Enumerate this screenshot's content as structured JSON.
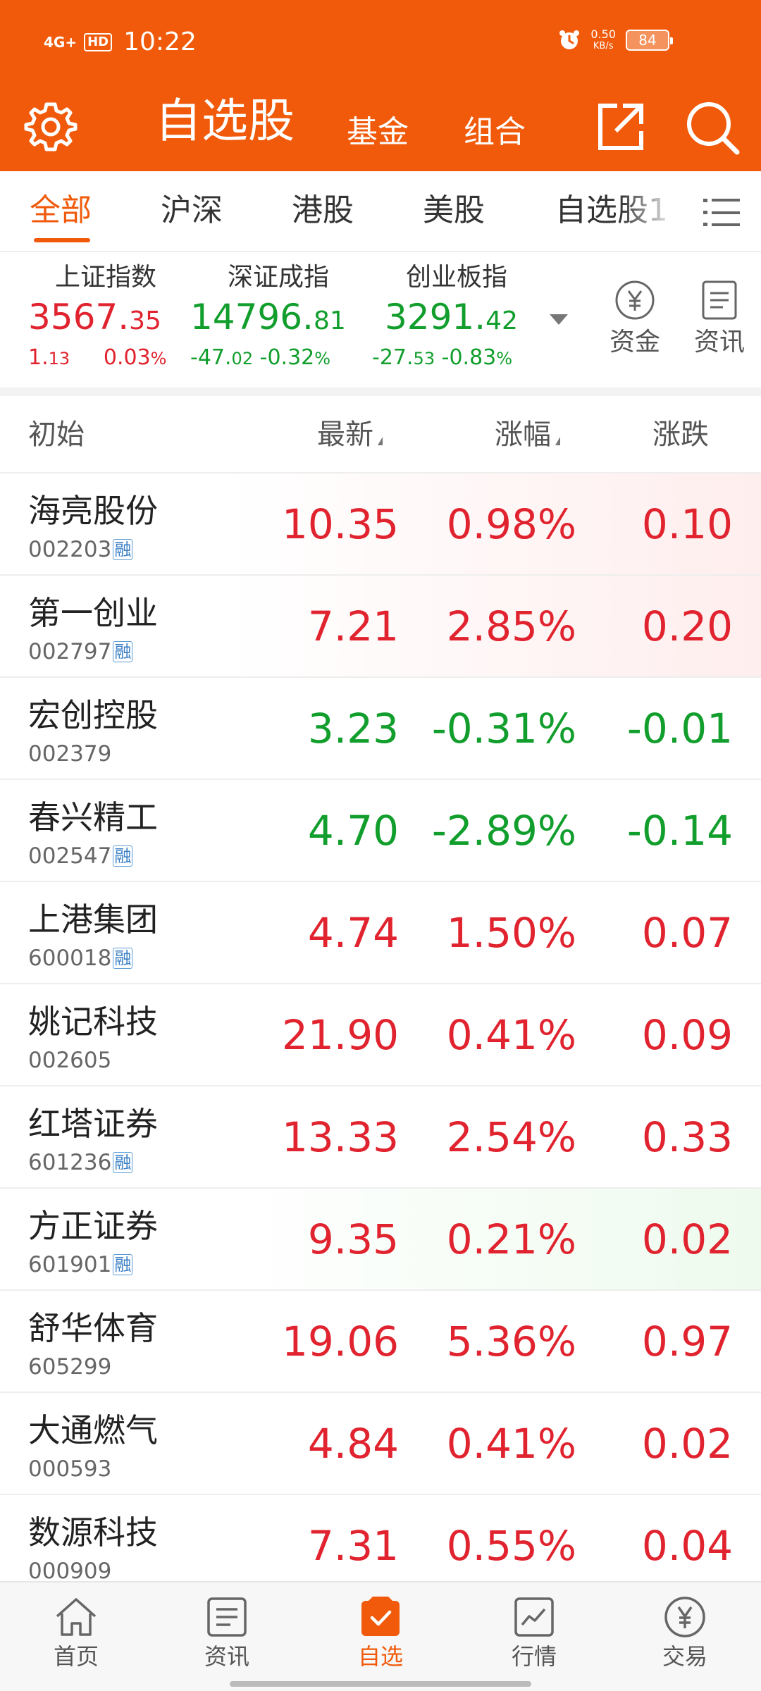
{
  "status_bar": {
    "network": "4G+",
    "hd": "HD",
    "time": "10:22",
    "speed_value": "0.50",
    "speed_unit": "KB/s",
    "battery": "84"
  },
  "header": {
    "title": "自选股",
    "tab_fund": "基金",
    "tab_combo": "组合"
  },
  "categories": [
    "全部",
    "沪深",
    "港股",
    "美股",
    "自选股1"
  ],
  "indices": [
    {
      "name": "上证指数",
      "value_int": "3567.",
      "value_dec": "35",
      "chg_int": "1.",
      "chg_dec": "13",
      "pct": "0.03",
      "pct_unit": "%"
    },
    {
      "name": "深证成指",
      "value_int": "14796.",
      "value_dec": "81",
      "chg_int": "-47.",
      "chg_dec": "02",
      "pct": "-0.32",
      "pct_unit": "%"
    },
    {
      "name": "创业板指",
      "value_int": "3291.",
      "value_dec": "42",
      "chg_int": "-27.",
      "chg_dec": "53",
      "pct": "-0.83",
      "pct_unit": "%"
    }
  ],
  "side_buttons": {
    "funds": "资金",
    "news": "资讯"
  },
  "table_header": {
    "initial": "初始",
    "latest": "最新",
    "change_pct": "涨幅",
    "change": "涨跌"
  },
  "rong_label": "融",
  "stocks": [
    {
      "name": "海亮股份",
      "code": "002203",
      "rong": true,
      "price": "10.35",
      "pct": "0.98%",
      "chg": "0.10",
      "dir": "up"
    },
    {
      "name": "第一创业",
      "code": "002797",
      "rong": true,
      "price": "7.21",
      "pct": "2.85%",
      "chg": "0.20",
      "dir": "up"
    },
    {
      "name": "宏创控股",
      "code": "002379",
      "rong": false,
      "price": "3.23",
      "pct": "-0.31%",
      "chg": "-0.01",
      "dir": "down"
    },
    {
      "name": "春兴精工",
      "code": "002547",
      "rong": true,
      "price": "4.70",
      "pct": "-2.89%",
      "chg": "-0.14",
      "dir": "down"
    },
    {
      "name": "上港集团",
      "code": "600018",
      "rong": true,
      "price": "4.74",
      "pct": "1.50%",
      "chg": "0.07",
      "dir": "up"
    },
    {
      "name": "姚记科技",
      "code": "002605",
      "rong": false,
      "price": "21.90",
      "pct": "0.41%",
      "chg": "0.09",
      "dir": "up"
    },
    {
      "name": "红塔证券",
      "code": "601236",
      "rong": true,
      "price": "13.33",
      "pct": "2.54%",
      "chg": "0.33",
      "dir": "up"
    },
    {
      "name": "方正证券",
      "code": "601901",
      "rong": true,
      "price": "9.35",
      "pct": "0.21%",
      "chg": "0.02",
      "dir": "up"
    },
    {
      "name": "舒华体育",
      "code": "605299",
      "rong": false,
      "price": "19.06",
      "pct": "5.36%",
      "chg": "0.97",
      "dir": "up"
    },
    {
      "name": "大通燃气",
      "code": "000593",
      "rong": false,
      "price": "4.84",
      "pct": "0.41%",
      "chg": "0.02",
      "dir": "up"
    },
    {
      "name": "数源科技",
      "code": "000909",
      "rong": false,
      "price": "7.31",
      "pct": "0.55%",
      "chg": "0.04",
      "dir": "up"
    }
  ],
  "bottom_nav": [
    {
      "label": "首页",
      "icon": "home-icon",
      "active": false
    },
    {
      "label": "资讯",
      "icon": "news-icon",
      "active": false
    },
    {
      "label": "自选",
      "icon": "watchlist-icon",
      "active": true
    },
    {
      "label": "行情",
      "icon": "market-chart-icon",
      "active": false
    },
    {
      "label": "交易",
      "icon": "yuan-trade-icon",
      "active": false
    }
  ],
  "colors": {
    "brand": "#f05a0a",
    "up": "#e0232e",
    "down": "#119e2c"
  }
}
